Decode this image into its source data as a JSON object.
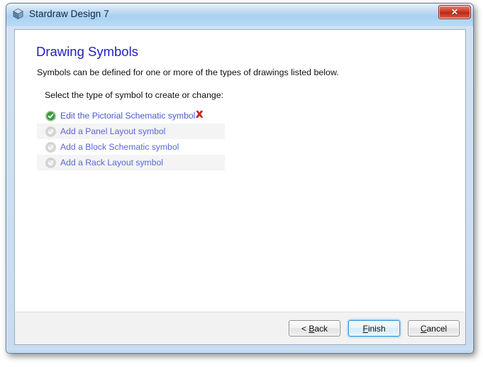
{
  "window": {
    "title": "Stardraw Design 7",
    "app_icon": "cube-app-icon",
    "close_label": "✕"
  },
  "page": {
    "title": "Drawing Symbols",
    "subtitle": "Symbols can be defined for one or more of the types of drawings listed below.",
    "prompt": "Select the type of symbol to create or change:"
  },
  "symbol_list": {
    "items": [
      {
        "label": "Edit the Pictorial Schematic symbol",
        "state": "enabled",
        "icon": "check-circle-green-icon",
        "has_delete": true
      },
      {
        "label": "Add a Panel Layout symbol",
        "state": "disabled",
        "icon": "check-circle-grey-icon",
        "has_delete": false
      },
      {
        "label": "Add a Block Schematic symbol",
        "state": "disabled",
        "icon": "check-circle-grey-icon",
        "has_delete": false
      },
      {
        "label": "Add a Rack Layout symbol",
        "state": "disabled",
        "icon": "check-circle-grey-icon",
        "has_delete": false
      }
    ],
    "delete_icon": "red-x-delete-icon"
  },
  "buttons": {
    "back": {
      "pre": "< ",
      "mnemonic": "B",
      "post": "ack"
    },
    "finish": {
      "pre": "",
      "mnemonic": "F",
      "post": "inish"
    },
    "cancel": {
      "pre": "",
      "mnemonic": "C",
      "post": "ancel"
    }
  },
  "colors": {
    "title_blue": "#2020c8",
    "link_blue": "#4a58cf",
    "check_green": "#3ba339",
    "delete_red": "#cc2222",
    "titlebar_blue": "#aad0f0",
    "close_red": "#c5301d"
  }
}
